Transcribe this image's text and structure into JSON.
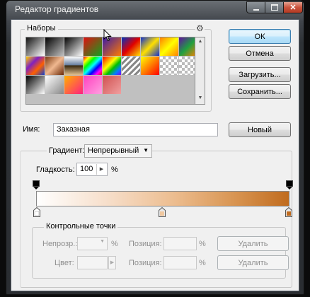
{
  "window": {
    "title": "Редактор градиентов"
  },
  "presets": {
    "label": "Наборы",
    "gear_icon": "gear-icon",
    "swatches": [
      {
        "name": "foreground-to-background",
        "css": "linear-gradient(135deg,#111 0%,#888 50%,#fff 100%)"
      },
      {
        "name": "foreground-to-transparent",
        "css": "linear-gradient(135deg,#000 0%,rgba(0,0,0,0) 100%)"
      },
      {
        "name": "black-white",
        "css": "linear-gradient(135deg,#000,#fff)"
      },
      {
        "name": "red-green",
        "css": "linear-gradient(135deg,#e01010,#10a020)"
      },
      {
        "name": "violet-orange",
        "css": "linear-gradient(135deg,#3a1aa8,#ff7a00)"
      },
      {
        "name": "blue-red-yellow",
        "css": "linear-gradient(135deg,#0030c0 0%,#e00000 50%,#ffe000 100%)"
      },
      {
        "name": "blue-yellow-blue",
        "css": "linear-gradient(135deg,#1030d0 0%,#ffe000 50%,#1030d0 100%)"
      },
      {
        "name": "orange-yellow-orange",
        "css": "linear-gradient(135deg,#ff8000 0%,#ffff00 50%,#ff8000 100%)"
      },
      {
        "name": "violet-green-orange",
        "css": "linear-gradient(135deg,#6010a0 0%,#20a040 50%,#ff8000 100%)"
      },
      {
        "name": "yellow-violet-orange-blue",
        "css": "linear-gradient(135deg,#ffd000 0%,#8020c0 35%,#ff6000 65%,#1040d0 100%)"
      },
      {
        "name": "copper",
        "css": "linear-gradient(135deg,#7a3a10 0%,#f0b890 50%,#6a2a08 100%)"
      },
      {
        "name": "chrome",
        "css": "linear-gradient(180deg,#fff 0%,#6a80a0 45%,#3a2a10 50%,#e0c090 100%)"
      },
      {
        "name": "spectrum",
        "css": "linear-gradient(135deg,#ff0000,#ffff00,#00ff00,#00ffff,#0000ff,#ff00ff,#ff0000)"
      },
      {
        "name": "transparent-rainbow",
        "css": "linear-gradient(135deg,#ff0000,#ff8000,#ffff00,#00c000,#0080ff,#8000ff)"
      },
      {
        "name": "transparent-stripes",
        "css": "repeating-linear-gradient(135deg,#888 0 3px,#fff 3px 6px)"
      },
      {
        "name": "yellow-red",
        "css": "linear-gradient(135deg,#ffff00,#ff0000)"
      },
      {
        "name": "checker-a",
        "css": "checker"
      },
      {
        "name": "checker-b",
        "css": "checker"
      },
      {
        "name": "black-white-b",
        "css": "linear-gradient(135deg,#000,#fff)"
      },
      {
        "name": "white-gray",
        "css": "linear-gradient(135deg,#fff,#888)"
      },
      {
        "name": "orange-pink",
        "css": "linear-gradient(135deg,#ffb000,#ff2080)"
      },
      {
        "name": "pink",
        "css": "linear-gradient(135deg,#ff40c0,#ffa0e0)"
      },
      {
        "name": "salmon",
        "css": "linear-gradient(135deg,#d05050,#f0a0a0)"
      }
    ]
  },
  "buttons": {
    "ok": "ОК",
    "cancel": "Отмена",
    "load": "Загрузить...",
    "save": "Сохранить...",
    "new": "Новый"
  },
  "name_field": {
    "label": "Имя:",
    "value": "Заказная"
  },
  "gradient": {
    "type_label": "Градиент:",
    "type_value": "Непрерывный",
    "smoothness_label": "Гладкость:",
    "smoothness_value": "100",
    "smoothness_unit": "%",
    "colors": [
      "#ffffff",
      "#c06b1e"
    ],
    "opacity_stops_percent": [
      0,
      100
    ],
    "color_stops_percent": [
      0,
      50,
      100
    ]
  },
  "stops_group": {
    "label": "Контрольные точки",
    "opacity_label": "Непрозр.:",
    "opacity_unit": "%",
    "opacity_position_label": "Позиция:",
    "opacity_position_unit": "%",
    "opacity_delete": "Удалить",
    "color_label": "Цвет:",
    "color_position_label": "Позиция:",
    "color_position_unit": "%",
    "color_delete": "Удалить"
  }
}
